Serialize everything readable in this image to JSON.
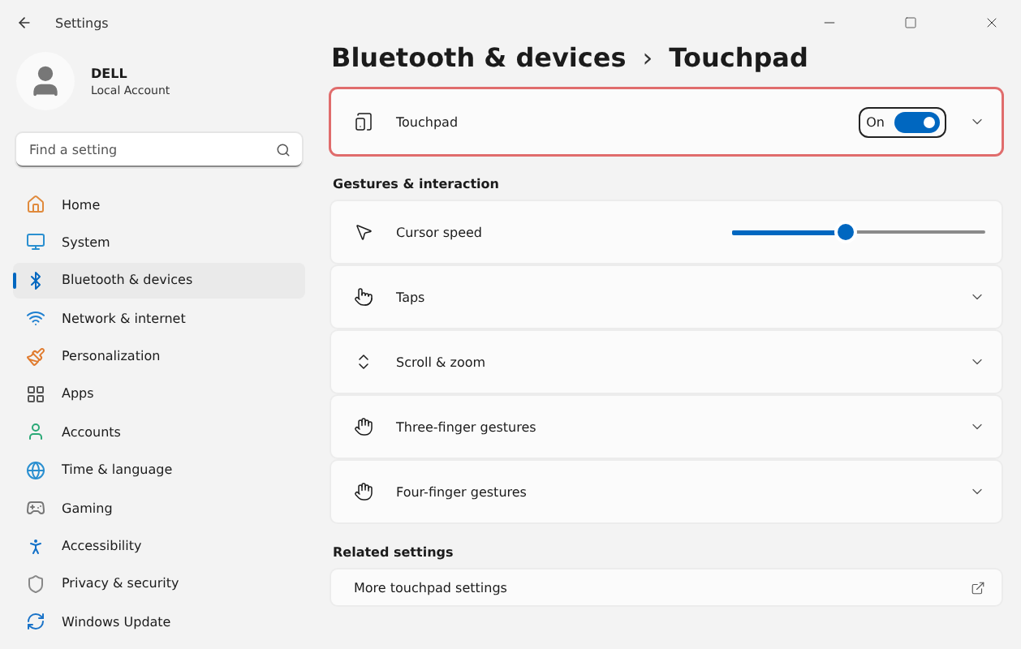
{
  "window": {
    "title": "Settings"
  },
  "profile": {
    "name": "DELL",
    "account": "Local Account"
  },
  "search": {
    "placeholder": "Find a setting"
  },
  "sidebar": {
    "items": [
      {
        "label": "Home",
        "selected": false
      },
      {
        "label": "System",
        "selected": false
      },
      {
        "label": "Bluetooth & devices",
        "selected": true
      },
      {
        "label": "Network & internet",
        "selected": false
      },
      {
        "label": "Personalization",
        "selected": false
      },
      {
        "label": "Apps",
        "selected": false
      },
      {
        "label": "Accounts",
        "selected": false
      },
      {
        "label": "Time & language",
        "selected": false
      },
      {
        "label": "Gaming",
        "selected": false
      },
      {
        "label": "Accessibility",
        "selected": false
      },
      {
        "label": "Privacy & security",
        "selected": false
      },
      {
        "label": "Windows Update",
        "selected": false
      }
    ]
  },
  "breadcrumb": {
    "parent": "Bluetooth & devices",
    "separator": "›",
    "current": "Touchpad"
  },
  "touchpad": {
    "label": "Touchpad",
    "state_text": "On",
    "on": true,
    "expanded": false,
    "highlighted": true
  },
  "sections": [
    {
      "title": "Gestures & interaction",
      "rows": [
        {
          "kind": "slider",
          "label": "Cursor speed",
          "level": 0.45
        },
        {
          "kind": "expander",
          "label": "Taps"
        },
        {
          "kind": "expander",
          "label": "Scroll & zoom"
        },
        {
          "kind": "expander",
          "label": "Three-finger gestures"
        },
        {
          "kind": "expander",
          "label": "Four-finger gestures"
        }
      ]
    },
    {
      "title": "Related settings",
      "rows": [
        {
          "kind": "link",
          "label": "More touchpad settings"
        }
      ]
    }
  ]
}
